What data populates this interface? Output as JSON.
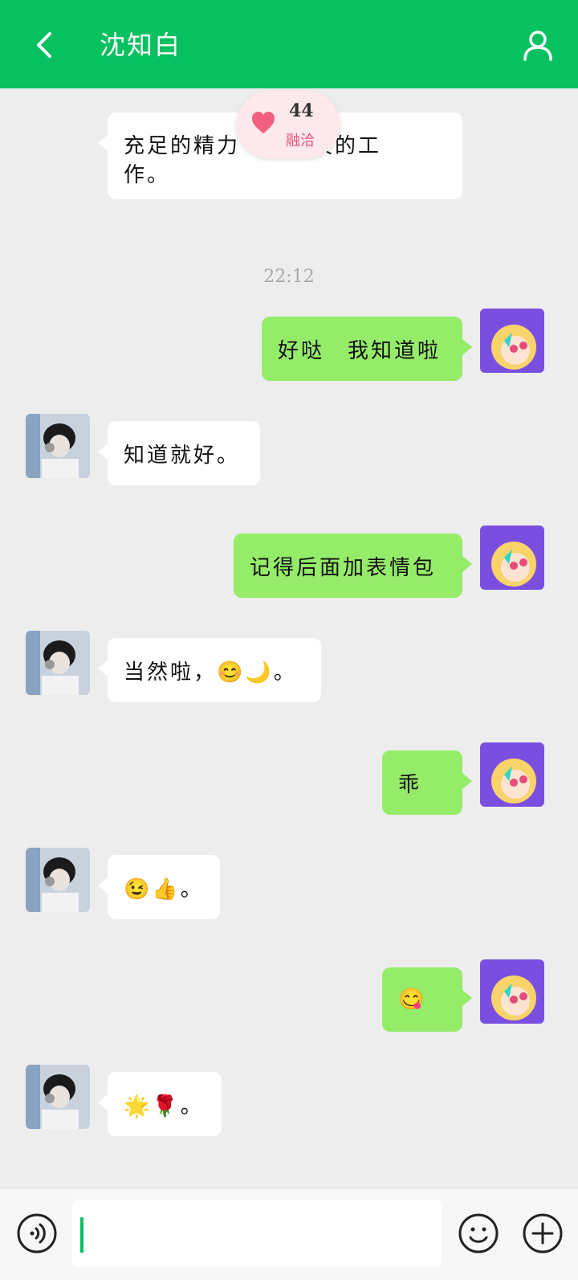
{
  "header": {
    "title": "沈知白",
    "back_icon": "chevron-left-icon",
    "profile_icon": "person-icon",
    "bg_color": "#07c160"
  },
  "affection": {
    "value": "44",
    "label": "融洽",
    "icon": "heart-icon"
  },
  "messages": [
    {
      "side": "in",
      "text_line1": "充足的精力",
      "text_line1_tail": "二天的工",
      "text_line2": "作。"
    },
    {
      "type": "time",
      "text": "22:12"
    },
    {
      "side": "out",
      "text": "好哒　我知道啦"
    },
    {
      "side": "in",
      "text": "知道就好。"
    },
    {
      "side": "out",
      "text": "记得后面加表情包"
    },
    {
      "side": "in",
      "text": "当然啦，😊🌙。"
    },
    {
      "side": "out",
      "text": "乖"
    },
    {
      "side": "in",
      "text": "😉👍。"
    },
    {
      "side": "out",
      "text": "😋"
    },
    {
      "side": "in",
      "text": "🌟🌹。"
    }
  ],
  "input": {
    "value": "",
    "voice_icon": "voice-icon",
    "emoji_icon": "smiley-icon",
    "plus_icon": "plus-icon"
  },
  "colors": {
    "accent": "#07c160",
    "out_bubble": "#95ec69",
    "in_bubble": "#ffffff",
    "background": "#ededed"
  }
}
